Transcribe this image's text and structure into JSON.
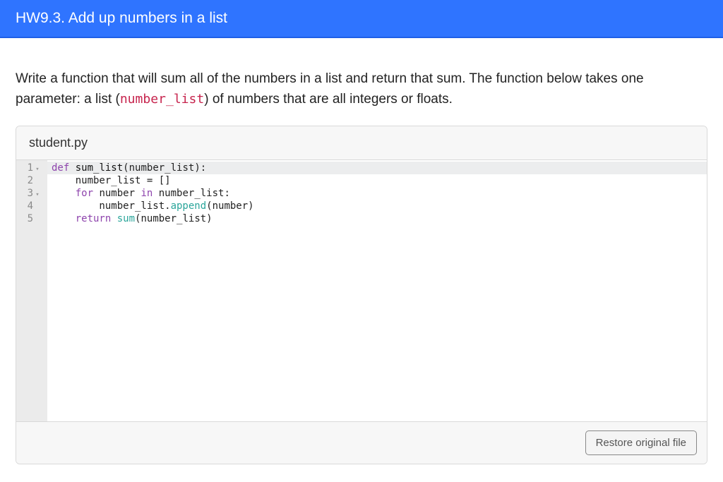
{
  "header": {
    "title": "HW9.3. Add up numbers in a list"
  },
  "prompt": {
    "text_before": "Write a function that will sum all of the numbers in a list and return that sum. The function below takes one parameter: a list (",
    "param": "number_list",
    "text_after": ") of numbers that are all integers or floats."
  },
  "editor": {
    "filename": "student.py",
    "gutter": {
      "lines": [
        {
          "n": "1",
          "fold": true
        },
        {
          "n": "2",
          "fold": false
        },
        {
          "n": "3",
          "fold": true
        },
        {
          "n": "4",
          "fold": false
        },
        {
          "n": "5",
          "fold": false
        }
      ]
    },
    "code": [
      {
        "active": true,
        "tokens": [
          {
            "cls": "tok-kw",
            "t": "def"
          },
          {
            "cls": "",
            "t": " "
          },
          {
            "cls": "tok-fn",
            "t": "sum_list"
          },
          {
            "cls": "",
            "t": "(number_list):"
          }
        ]
      },
      {
        "active": false,
        "tokens": [
          {
            "cls": "",
            "t": "    number_list = []"
          }
        ]
      },
      {
        "active": false,
        "tokens": [
          {
            "cls": "",
            "t": "    "
          },
          {
            "cls": "tok-kw",
            "t": "for"
          },
          {
            "cls": "",
            "t": " number "
          },
          {
            "cls": "tok-kw",
            "t": "in"
          },
          {
            "cls": "",
            "t": " number_list:"
          }
        ]
      },
      {
        "active": false,
        "tokens": [
          {
            "cls": "",
            "t": "        number_list."
          },
          {
            "cls": "tok-call",
            "t": "append"
          },
          {
            "cls": "",
            "t": "(number)"
          }
        ]
      },
      {
        "active": false,
        "tokens": [
          {
            "cls": "",
            "t": "    "
          },
          {
            "cls": "tok-kw",
            "t": "return"
          },
          {
            "cls": "",
            "t": " "
          },
          {
            "cls": "tok-bi",
            "t": "sum"
          },
          {
            "cls": "",
            "t": "(number_list)"
          }
        ]
      }
    ],
    "footer": {
      "restore_label": "Restore original file"
    }
  }
}
